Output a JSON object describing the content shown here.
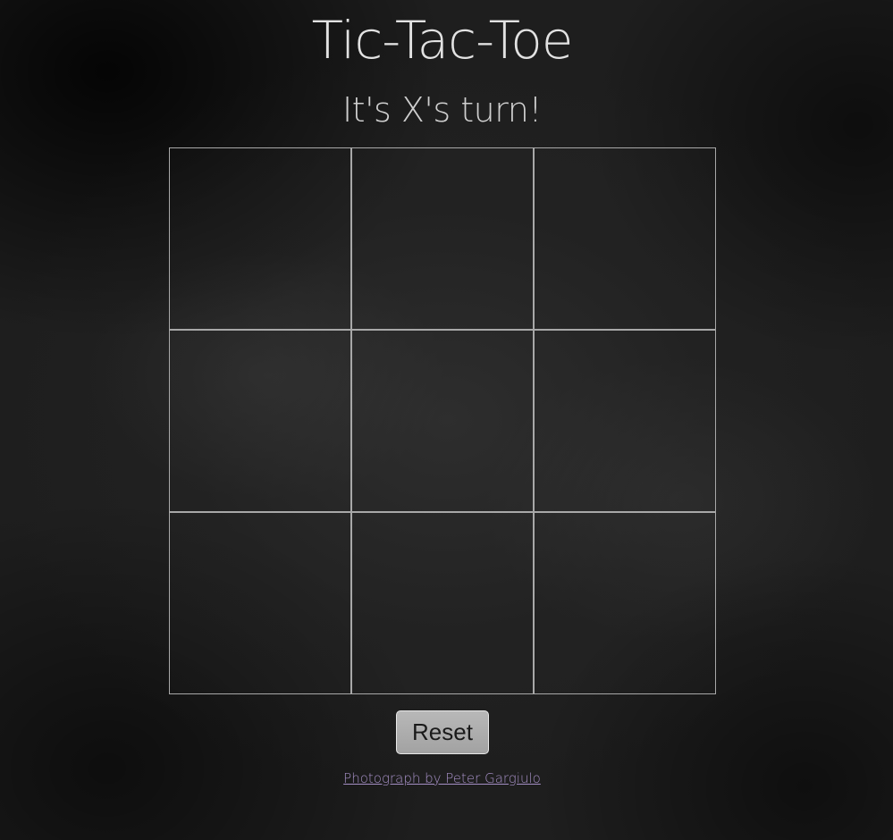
{
  "game": {
    "title": "Tic-Tac-Toe",
    "status": "It's X's turn!",
    "board": [
      "",
      "",
      "",
      "",
      "",
      "",
      "",
      "",
      ""
    ]
  },
  "controls": {
    "reset_label": "Reset"
  },
  "footer": {
    "credit_text": "Photograph by Peter Gargiulo"
  },
  "colors": {
    "grid_line": "#a8a8a8",
    "text": "#e2e2e2",
    "link": "#a58fc5",
    "button_bg": "#aeaeae"
  }
}
